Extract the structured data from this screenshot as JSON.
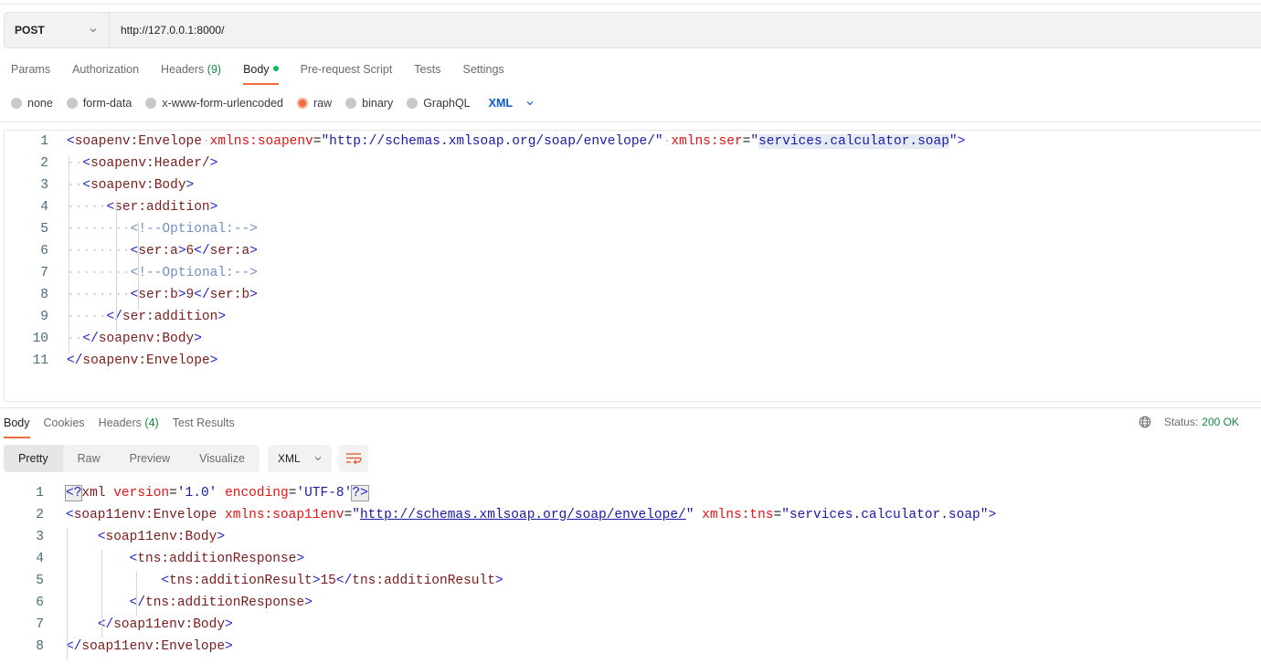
{
  "request": {
    "method": "POST",
    "url": "http://127.0.0.1:8000/",
    "tabs": [
      {
        "label": "Params"
      },
      {
        "label": "Authorization"
      },
      {
        "label": "Headers",
        "count": "(9)"
      },
      {
        "label": "Body",
        "active": true,
        "indicator": "green-dot"
      },
      {
        "label": "Pre-request Script"
      },
      {
        "label": "Tests"
      },
      {
        "label": "Settings"
      }
    ],
    "body_types": [
      {
        "label": "none",
        "checked": false
      },
      {
        "label": "form-data",
        "checked": false
      },
      {
        "label": "x-www-form-urlencoded",
        "checked": false
      },
      {
        "label": "raw",
        "checked": true
      },
      {
        "label": "binary",
        "checked": false
      },
      {
        "label": "GraphQL",
        "checked": false
      }
    ],
    "raw_language": "XML",
    "body_lines": [
      {
        "n": "1",
        "text": "<soapenv:Envelope xmlns:soapenv=\"http://schemas.xmlsoap.org/soap/envelope/\" xmlns:ser=\"services.calculator.soap\">"
      },
      {
        "n": "2",
        "text": "  <soapenv:Header/>"
      },
      {
        "n": "3",
        "text": "  <soapenv:Body>"
      },
      {
        "n": "4",
        "text": "     <ser:addition>"
      },
      {
        "n": "5",
        "text": "        <!--Optional:-->"
      },
      {
        "n": "6",
        "text": "        <ser:a>6</ser:a>"
      },
      {
        "n": "7",
        "text": "        <!--Optional:-->"
      },
      {
        "n": "8",
        "text": "        <ser:b>9</ser:b>"
      },
      {
        "n": "9",
        "text": "     </ser:addition>"
      },
      {
        "n": "10",
        "text": "  </soapenv:Body>"
      },
      {
        "n": "11",
        "text": "</soapenv:Envelope>"
      }
    ],
    "selected_text": "services.calculator.soap"
  },
  "response": {
    "tabs": [
      {
        "label": "Body",
        "active": true
      },
      {
        "label": "Cookies"
      },
      {
        "label": "Headers",
        "count": "(4)"
      },
      {
        "label": "Test Results"
      }
    ],
    "status_label": "Status:",
    "status_value": "200 OK",
    "status_color": "#0f8a3b",
    "view_modes": [
      {
        "label": "Pretty",
        "active": true
      },
      {
        "label": "Raw"
      },
      {
        "label": "Preview"
      },
      {
        "label": "Visualize"
      }
    ],
    "format": "XML",
    "wrap_icon": "wrap-lines-icon",
    "body_lines": [
      {
        "n": "1",
        "text": "<?xml version='1.0' encoding='UTF-8'?>"
      },
      {
        "n": "2",
        "text": "<soap11env:Envelope xmlns:soap11env=\"http://schemas.xmlsoap.org/soap/envelope/\" xmlns:tns=\"services.calculator.soap\">"
      },
      {
        "n": "3",
        "text": "    <soap11env:Body>"
      },
      {
        "n": "4",
        "text": "        <tns:additionResponse>"
      },
      {
        "n": "5",
        "text": "            <tns:additionResult>15</tns:additionResult>"
      },
      {
        "n": "6",
        "text": "        </tns:additionResponse>"
      },
      {
        "n": "7",
        "text": "    </soap11env:Body>"
      },
      {
        "n": "8",
        "text": "</soap11env:Envelope>"
      }
    ]
  },
  "colors": {
    "accent": "#f26b3a",
    "xml_language": "#0b5cd0",
    "success": "#0f8a3b"
  }
}
